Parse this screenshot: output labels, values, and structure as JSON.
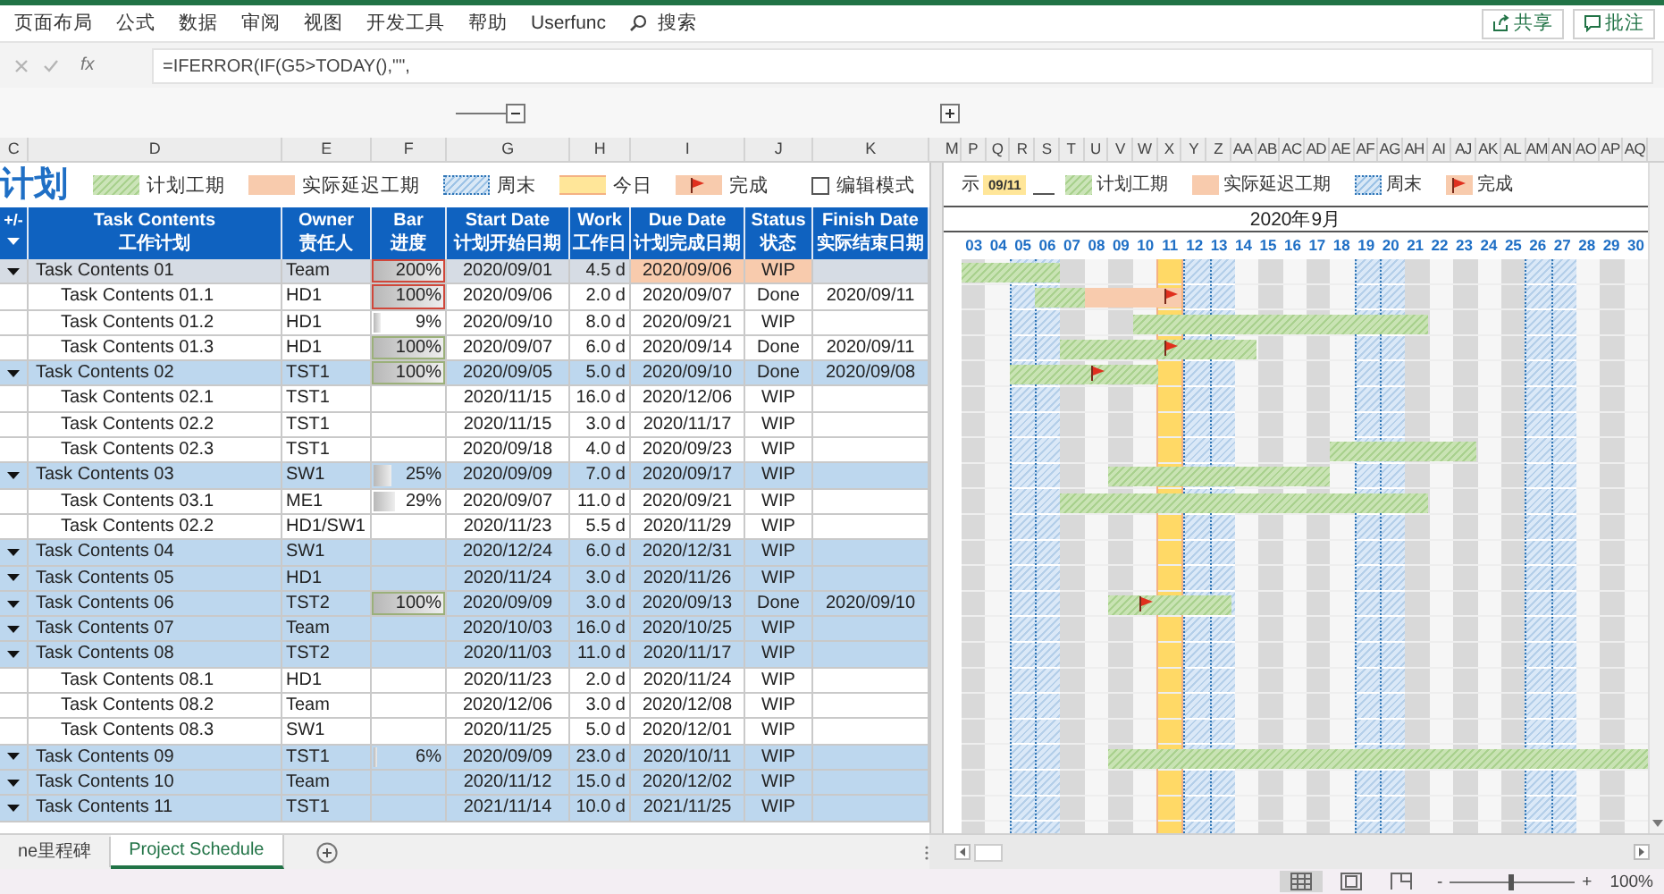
{
  "ribbon": {
    "tabs": [
      "页面布局",
      "公式",
      "数据",
      "审阅",
      "视图",
      "开发工具",
      "帮助",
      "Userfunc"
    ],
    "search": "搜索",
    "buttons": [
      {
        "kind": "share",
        "label": "共享"
      },
      {
        "kind": "comment",
        "label": "批注"
      }
    ]
  },
  "formula_bar": {
    "label": "fx",
    "formula": "=IFERROR(IF(G5>TODAY(),\"\","
  },
  "column_letters": {
    "left": [
      "C",
      "D",
      "E",
      "F",
      "G",
      "H",
      "I",
      "J",
      "K"
    ],
    "right": [
      "M",
      "P",
      "Q",
      "R",
      "S",
      "T",
      "U",
      "V",
      "W",
      "X",
      "Y",
      "Z",
      "AA",
      "AB",
      "AC",
      "AD",
      "AE",
      "AF",
      "AG",
      "AH",
      "AI",
      "AJ",
      "AK",
      "AL",
      "AM",
      "AN",
      "AO",
      "AP",
      "AQ"
    ]
  },
  "legend": {
    "title": "计划",
    "items": [
      {
        "kind": "plan",
        "label": "计划工期"
      },
      {
        "kind": "delay",
        "label": "实际延迟工期"
      },
      {
        "kind": "weekend",
        "label": "周末"
      },
      {
        "kind": "today",
        "label": "今日"
      },
      {
        "kind": "done",
        "label": "完成"
      }
    ],
    "edit_mode": {
      "label": "编辑模式",
      "checked": false
    }
  },
  "table": {
    "columns": [
      {
        "en": "+/-"
      },
      {
        "en": "Task Contents",
        "zh": "工作计划"
      },
      {
        "en": "Owner",
        "zh": "责任人"
      },
      {
        "en": "Bar",
        "zh": "进度"
      },
      {
        "en": "Start Date",
        "zh": "计划开始日期"
      },
      {
        "en": "Work",
        "zh": "工作日"
      },
      {
        "en": "Due Date",
        "zh": "计划完成日期"
      },
      {
        "en": "Status",
        "zh": "状态"
      },
      {
        "en": "Finish Date",
        "zh": "实际结束日期"
      }
    ],
    "rows": [
      {
        "kind": "group",
        "selected": true,
        "overdue": true,
        "name": "Task Contents 01",
        "owner": "Team",
        "bar": "200%",
        "level": 1,
        "bar_alert": true,
        "bar_complete": false,
        "start": "2020/09/01",
        "work": "4.5 d",
        "due": "2020/09/06",
        "status": "WIP"
      },
      {
        "kind": "task",
        "selected": false,
        "overdue": false,
        "name": "Task Contents 01.1",
        "owner": "HD1",
        "bar": "100%",
        "level": 1,
        "bar_alert": true,
        "bar_complete": false,
        "start": "2020/09/06",
        "work": "2.0 d",
        "due": "2020/09/07",
        "status": "Done",
        "finish": "2020/09/11"
      },
      {
        "kind": "task",
        "selected": false,
        "overdue": false,
        "name": "Task Contents 01.2",
        "owner": "HD1",
        "bar": "9%",
        "level": 0.09,
        "bar_alert": false,
        "bar_complete": false,
        "start": "2020/09/10",
        "work": "8.0 d",
        "due": "2020/09/21",
        "status": "WIP"
      },
      {
        "kind": "task",
        "selected": false,
        "overdue": false,
        "name": "Task Contents 01.3",
        "owner": "HD1",
        "bar": "100%",
        "level": 1,
        "bar_alert": false,
        "bar_complete": true,
        "start": "2020/09/07",
        "work": "6.0 d",
        "due": "2020/09/14",
        "status": "Done",
        "finish": "2020/09/11"
      },
      {
        "kind": "group",
        "selected": false,
        "overdue": false,
        "name": "Task Contents 02",
        "owner": "TST1",
        "bar": "100%",
        "level": 1,
        "bar_alert": false,
        "bar_complete": true,
        "start": "2020/09/05",
        "work": "5.0 d",
        "due": "2020/09/10",
        "status": "Done",
        "finish": "2020/09/08"
      },
      {
        "kind": "task",
        "selected": false,
        "overdue": false,
        "name": "Task Contents 02.1",
        "owner": "TST1",
        "start": "2020/11/15",
        "work": "16.0 d",
        "due": "2020/12/06",
        "status": "WIP"
      },
      {
        "kind": "task",
        "selected": false,
        "overdue": false,
        "name": "Task Contents 02.2",
        "owner": "TST1",
        "start": "2020/11/15",
        "work": "3.0 d",
        "due": "2020/11/17",
        "status": "WIP"
      },
      {
        "kind": "task",
        "selected": false,
        "overdue": false,
        "name": "Task Contents 02.3",
        "owner": "TST1",
        "start": "2020/09/18",
        "work": "4.0 d",
        "due": "2020/09/23",
        "status": "WIP"
      },
      {
        "kind": "group",
        "selected": false,
        "overdue": false,
        "name": "Task Contents 03",
        "owner": "SW1",
        "bar": "25%",
        "level": 0.25,
        "bar_alert": false,
        "bar_complete": false,
        "start": "2020/09/09",
        "work": "7.0 d",
        "due": "2020/09/17",
        "status": "WIP"
      },
      {
        "kind": "task",
        "selected": false,
        "overdue": false,
        "name": "Task Contents 03.1",
        "owner": "ME1",
        "bar": "29%",
        "level": 0.29,
        "bar_alert": false,
        "bar_complete": false,
        "start": "2020/09/07",
        "work": "11.0 d",
        "due": "2020/09/21",
        "status": "WIP"
      },
      {
        "kind": "task",
        "selected": false,
        "overdue": false,
        "name": "Task Contents 02.2",
        "owner": "HD1/SW1",
        "start": "2020/11/23",
        "work": "5.5 d",
        "due": "2020/11/29",
        "status": "WIP"
      },
      {
        "kind": "group",
        "selected": false,
        "overdue": false,
        "name": "Task Contents 04",
        "owner": "SW1",
        "start": "2020/12/24",
        "work": "6.0 d",
        "due": "2020/12/31",
        "status": "WIP"
      },
      {
        "kind": "group",
        "selected": false,
        "overdue": false,
        "name": "Task Contents 05",
        "owner": "HD1",
        "start": "2020/11/24",
        "work": "3.0 d",
        "due": "2020/11/26",
        "status": "WIP"
      },
      {
        "kind": "group",
        "selected": false,
        "overdue": false,
        "name": "Task Contents 06",
        "owner": "TST2",
        "bar": "100%",
        "level": 1,
        "bar_alert": false,
        "bar_complete": true,
        "start": "2020/09/09",
        "work": "3.0 d",
        "due": "2020/09/13",
        "status": "Done",
        "finish": "2020/09/10"
      },
      {
        "kind": "group",
        "selected": false,
        "overdue": false,
        "name": "Task Contents 07",
        "owner": "Team",
        "start": "2020/10/03",
        "work": "16.0 d",
        "due": "2020/10/25",
        "status": "WIP"
      },
      {
        "kind": "group",
        "selected": false,
        "overdue": false,
        "name": "Task Contents 08",
        "owner": "TST2",
        "start": "2020/11/03",
        "work": "11.0 d",
        "due": "2020/11/17",
        "status": "WIP"
      },
      {
        "kind": "task",
        "selected": false,
        "overdue": false,
        "name": "Task Contents 08.1",
        "owner": "HD1",
        "start": "2020/11/23",
        "work": "2.0 d",
        "due": "2020/11/24",
        "status": "WIP"
      },
      {
        "kind": "task",
        "selected": false,
        "overdue": false,
        "name": "Task Contents 08.2",
        "owner": "Team",
        "start": "2020/12/06",
        "work": "3.0 d",
        "due": "2020/12/08",
        "status": "WIP"
      },
      {
        "kind": "task",
        "selected": false,
        "overdue": false,
        "name": "Task Contents 08.3",
        "owner": "SW1",
        "start": "2020/11/25",
        "work": "5.0 d",
        "due": "2020/12/01",
        "status": "WIP"
      },
      {
        "kind": "group",
        "selected": false,
        "overdue": false,
        "name": "Task Contents 09",
        "owner": "TST1",
        "bar": "6%",
        "level": 0.06,
        "bar_alert": false,
        "bar_complete": false,
        "start": "2020/09/09",
        "work": "23.0 d",
        "due": "2020/10/11",
        "status": "WIP"
      },
      {
        "kind": "group",
        "selected": false,
        "overdue": false,
        "name": "Task Contents 10",
        "owner": "Team",
        "start": "2020/11/12",
        "work": "15.0 d",
        "due": "2020/12/02",
        "status": "WIP"
      },
      {
        "kind": "group",
        "selected": false,
        "overdue": false,
        "name": "Task Contents 11",
        "owner": "TST1",
        "start": "2021/11/14",
        "work": "10.0 d",
        "due": "2021/11/25",
        "status": "WIP"
      }
    ]
  },
  "gantt": {
    "prefix": "示",
    "today_label": "09/11",
    "legend": [
      {
        "kind": "plan",
        "label": "计划工期"
      },
      {
        "kind": "delay",
        "label": "实际延迟工期"
      },
      {
        "kind": "weekend",
        "label": "周末"
      },
      {
        "kind": "done",
        "label": "完成"
      }
    ],
    "month": "2020年9月",
    "days": [
      {
        "label": "03",
        "weekend": false,
        "today": false
      },
      {
        "label": "04",
        "weekend": false,
        "today": false
      },
      {
        "label": "05",
        "weekend": true,
        "today": false
      },
      {
        "label": "06",
        "weekend": true,
        "today": false
      },
      {
        "label": "07",
        "weekend": false,
        "today": false
      },
      {
        "label": "08",
        "weekend": false,
        "today": false
      },
      {
        "label": "09",
        "weekend": false,
        "today": false
      },
      {
        "label": "10",
        "weekend": false,
        "today": false
      },
      {
        "label": "11",
        "weekend": false,
        "today": true
      },
      {
        "label": "12",
        "weekend": true,
        "today": false
      },
      {
        "label": "13",
        "weekend": true,
        "today": false
      },
      {
        "label": "14",
        "weekend": false,
        "today": false
      },
      {
        "label": "15",
        "weekend": false,
        "today": false
      },
      {
        "label": "16",
        "weekend": false,
        "today": false
      },
      {
        "label": "17",
        "weekend": false,
        "today": false
      },
      {
        "label": "18",
        "weekend": false,
        "today": false
      },
      {
        "label": "19",
        "weekend": true,
        "today": false
      },
      {
        "label": "20",
        "weekend": true,
        "today": false
      },
      {
        "label": "21",
        "weekend": false,
        "today": false
      },
      {
        "label": "22",
        "weekend": false,
        "today": false
      },
      {
        "label": "23",
        "weekend": false,
        "today": false
      },
      {
        "label": "24",
        "weekend": false,
        "today": false
      },
      {
        "label": "25",
        "weekend": false,
        "today": false
      },
      {
        "label": "26",
        "weekend": true,
        "today": false
      },
      {
        "label": "27",
        "weekend": true,
        "today": false
      },
      {
        "label": "28",
        "weekend": false,
        "today": false
      },
      {
        "label": "29",
        "weekend": false,
        "today": false
      },
      {
        "label": "30",
        "weekend": false,
        "today": false
      }
    ]
  },
  "sheet_tabs": [
    {
      "label": "ne里程碑",
      "selected": false
    },
    {
      "label": "Project Schedule",
      "selected": true
    }
  ],
  "status_bar": {
    "views": [
      {
        "kind": "normal",
        "selected": true
      },
      {
        "kind": "layout",
        "selected": false
      },
      {
        "kind": "pagebreak",
        "selected": false
      }
    ],
    "zoom_out": "-",
    "zoom_in": "+",
    "zoom": {
      "level": 0.5
    },
    "zoom_label": "100%"
  }
}
